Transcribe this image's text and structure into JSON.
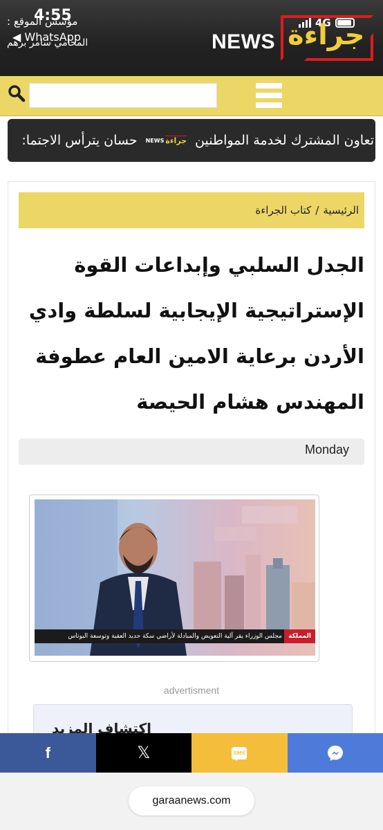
{
  "status": {
    "time": "4:55",
    "back_app": "◀ WhatsApp",
    "network": "4G"
  },
  "header": {
    "founder_line1": "مؤسس الموقع :",
    "founder_line2": "المحامي سامر برهم",
    "logo_news": "NEWS",
    "logo_arabic": "جراءة",
    "colors": {
      "logo_red": "#e21b1b",
      "logo_yellow": "#f2cc3b",
      "bar_yellow": "#ecd666"
    }
  },
  "search": {
    "value": "",
    "placeholder": ""
  },
  "ticker": {
    "item_left": "حسان يترأس الاجتما:",
    "item_right": "تعاون المشترك لخدمة المواطنين",
    "logo_news": "NEWS",
    "logo_ar": "جراءة"
  },
  "breadcrumb": {
    "home": "الرئيسية",
    "separator": "/",
    "section": "كتاب الجراءة"
  },
  "article": {
    "title": "الجدل السلبي وإبداعات القوة الإستراتيجية الإيجابية لسلطة وادي الأردن برعاية الامين العام عطوفة المهندس هشام الحيصة",
    "date": "Monday",
    "image": {
      "tv_brand": "المملكة",
      "tv_caption": "مجلس الوزراء يقر آلية التعويض والمبادلة لأراضي سكة حديد العقبة وتوسعة البوتاس"
    }
  },
  "ad": {
    "label": "advertisment",
    "title": "اكتشاف المزيد"
  },
  "share": {
    "facebook": "f",
    "x": "𝕏",
    "sms": "SMS"
  },
  "browser": {
    "url": "garaanews.com"
  }
}
